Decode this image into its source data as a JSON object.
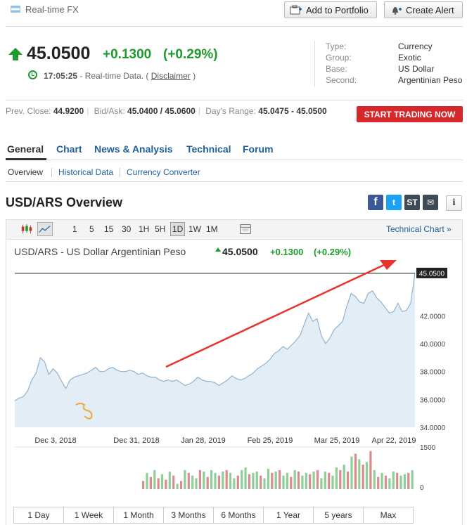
{
  "header": {
    "section_label": "Real-time FX",
    "add_portfolio": "Add to Portfolio",
    "create_alert": "Create Alert"
  },
  "quote": {
    "price": "45.0500",
    "change": "+0.1300",
    "change_pct": "(+0.29%)",
    "time": "17:05:25",
    "rt_text": " - Real-time Data. ( ",
    "disclaimer": "Disclaimer",
    "rt_close": " )"
  },
  "info": [
    {
      "k": "Type:",
      "v": "Currency"
    },
    {
      "k": "Group:",
      "v": "Exotic"
    },
    {
      "k": "Base:",
      "v": "US Dollar"
    },
    {
      "k": "Second:",
      "v": "Argentinian Peso"
    }
  ],
  "stats": {
    "prev_close_label": "Prev. Close:",
    "prev_close": "44.9200",
    "bid_ask_label": "Bid/Ask:",
    "bid_ask": "45.0400 / 45.0600",
    "range_label": "Day's Range:",
    "range": "45.0475 - 45.0500"
  },
  "trade_button": "START TRADING NOW",
  "tabs": [
    "General",
    "Chart",
    "News & Analysis",
    "Technical",
    "Forum"
  ],
  "subtabs": [
    "Overview",
    "Historical Data",
    "Currency Converter"
  ],
  "overview_title": "USD/ARS Overview",
  "share": {
    "fb": "f",
    "tw": "t",
    "st": "ST",
    "email": "✉",
    "info": "i"
  },
  "toolbar": {
    "periods": [
      "1",
      "5",
      "15",
      "30",
      "1H",
      "5H",
      "1D",
      "1W",
      "1M"
    ],
    "selected_period": "1D",
    "technical_chart": "Technical Chart »"
  },
  "chart_header": {
    "pair": "USD/ARS - US Dollar Argentinian Peso",
    "price": "45.0500",
    "change": "+0.1300",
    "change_pct": "(+0.29%)"
  },
  "ranges": [
    "1 Day",
    "1 Week",
    "1 Month",
    "3 Months",
    "6 Months",
    "1 Year",
    "5 years",
    "Max"
  ],
  "colors": {
    "up": "#1e9b2e",
    "link": "#1f5f9a",
    "trade": "#d6282a",
    "area": "#e3edf5",
    "line": "#8fb3d1",
    "arrow": "#e8332a"
  },
  "chart_data": {
    "type": "area",
    "x_tick_labels": [
      "Dec 3, 2018",
      "Dec 31, 2018",
      "Jan 28, 2019",
      "Feb 25, 2019",
      "Mar 25, 2019",
      "Apr 22, 2019"
    ],
    "y_tick_labels": [
      "34.0000",
      "36.0000",
      "38.0000",
      "40.0000",
      "42.0000"
    ],
    "ylim": [
      34,
      45.5
    ],
    "last_value_label": "45.0500",
    "volume_tick_labels": [
      "1500",
      "0"
    ],
    "series": [
      {
        "values": [
          35.9,
          36.1,
          36.2,
          36.6,
          37.4,
          37.9,
          39.0,
          38.7,
          37.8,
          38.2,
          37.9,
          37.3,
          36.8,
          37.4,
          37.6,
          37.7,
          37.8,
          37.9,
          38.1,
          38.3,
          38.0,
          38.0,
          38.2,
          38.3,
          38.1,
          38.0,
          38.0,
          38.1,
          38.0,
          37.8,
          37.9,
          37.7,
          37.6,
          37.6,
          37.4,
          37.3,
          37.4,
          37.3,
          37.4,
          37.2,
          37.0,
          37.1,
          37.3,
          37.6,
          37.4,
          37.3,
          37.3,
          37.2,
          37.0,
          37.2,
          37.4,
          37.7,
          37.5,
          37.4,
          37.5,
          37.7,
          37.9,
          38.2,
          38.4,
          38.6,
          38.9,
          39.3,
          39.5,
          39.8,
          39.6,
          39.9,
          40.2,
          40.6,
          41.4,
          42.2,
          41.6,
          41.8,
          40.6,
          40.0,
          40.4,
          41.0,
          41.3,
          41.6,
          42.7,
          43.6,
          43.4,
          43.0,
          42.9,
          43.6,
          43.8,
          43.3,
          43.0,
          42.6,
          42.2,
          42.3,
          42.9,
          42.3,
          42.4,
          42.9,
          45.05
        ]
      }
    ],
    "volume": [
      0,
      0,
      0,
      0,
      0,
      0,
      0,
      0,
      0,
      0,
      0,
      0,
      0,
      0,
      0,
      0,
      0,
      0,
      0,
      0,
      0,
      0,
      0,
      0,
      0,
      0,
      0,
      0,
      0,
      0,
      0,
      0,
      0,
      0,
      0,
      0,
      0,
      0,
      0,
      0,
      0,
      0,
      0,
      0,
      0,
      0,
      0,
      0,
      0,
      0,
      0,
      0,
      0,
      0,
      0,
      0,
      0,
      0,
      0,
      0,
      0,
      0,
      0,
      0,
      0,
      0,
      0,
      0,
      0,
      0,
      0,
      0,
      0,
      0,
      0,
      0,
      0,
      0,
      0,
      0,
      0,
      0,
      0,
      0,
      0,
      0,
      0,
      0,
      0,
      0,
      0,
      0,
      0,
      0,
      0
    ],
    "volume_bars": [
      {
        "v": 300,
        "up": false
      },
      {
        "v": 600,
        "up": true
      },
      {
        "v": 450,
        "up": false
      },
      {
        "v": 700,
        "up": true
      },
      {
        "v": 400,
        "up": false
      },
      {
        "v": 550,
        "up": true
      },
      {
        "v": 350,
        "up": false
      },
      {
        "v": 650,
        "up": true
      },
      {
        "v": 500,
        "up": false
      },
      {
        "v": 200,
        "up": true
      },
      {
        "v": 300,
        "up": false
      },
      {
        "v": 700,
        "up": true
      },
      {
        "v": 600,
        "up": false
      },
      {
        "v": 500,
        "up": true
      },
      {
        "v": 400,
        "up": true
      },
      {
        "v": 700,
        "up": false
      },
      {
        "v": 650,
        "up": true
      },
      {
        "v": 450,
        "up": false
      },
      {
        "v": 700,
        "up": true
      },
      {
        "v": 600,
        "up": true
      },
      {
        "v": 500,
        "up": false
      },
      {
        "v": 650,
        "up": true
      },
      {
        "v": 700,
        "up": false
      },
      {
        "v": 600,
        "up": true
      },
      {
        "v": 400,
        "up": true
      },
      {
        "v": 500,
        "up": false
      },
      {
        "v": 700,
        "up": true
      },
      {
        "v": 800,
        "up": true
      },
      {
        "v": 550,
        "up": false
      },
      {
        "v": 600,
        "up": true
      },
      {
        "v": 650,
        "up": true
      },
      {
        "v": 500,
        "up": false
      },
      {
        "v": 400,
        "up": true
      },
      {
        "v": 750,
        "up": true
      },
      {
        "v": 600,
        "up": false
      },
      {
        "v": 650,
        "up": true
      },
      {
        "v": 700,
        "up": false
      },
      {
        "v": 500,
        "up": true
      },
      {
        "v": 600,
        "up": true
      },
      {
        "v": 450,
        "up": false
      },
      {
        "v": 700,
        "up": true
      },
      {
        "v": 650,
        "up": false
      },
      {
        "v": 500,
        "up": true
      },
      {
        "v": 600,
        "up": true
      },
      {
        "v": 550,
        "up": false
      },
      {
        "v": 650,
        "up": true
      },
      {
        "v": 700,
        "up": false
      },
      {
        "v": 400,
        "up": true
      },
      {
        "v": 650,
        "up": true
      },
      {
        "v": 600,
        "up": false
      },
      {
        "v": 500,
        "up": true
      },
      {
        "v": 800,
        "up": true
      },
      {
        "v": 700,
        "up": false
      },
      {
        "v": 900,
        "up": true
      },
      {
        "v": 650,
        "up": false
      },
      {
        "v": 1200,
        "up": true
      },
      {
        "v": 1300,
        "up": false
      },
      {
        "v": 1100,
        "up": true
      },
      {
        "v": 900,
        "up": false
      },
      {
        "v": 1000,
        "up": true
      },
      {
        "v": 1400,
        "up": false
      },
      {
        "v": 700,
        "up": true
      },
      {
        "v": 450,
        "up": false
      },
      {
        "v": 600,
        "up": true
      },
      {
        "v": 500,
        "up": false
      },
      {
        "v": 400,
        "up": true
      },
      {
        "v": 650,
        "up": true
      },
      {
        "v": 600,
        "up": false
      },
      {
        "v": 500,
        "up": true
      },
      {
        "v": 550,
        "up": true
      },
      {
        "v": 600,
        "up": false
      },
      {
        "v": 700,
        "up": true
      }
    ]
  }
}
